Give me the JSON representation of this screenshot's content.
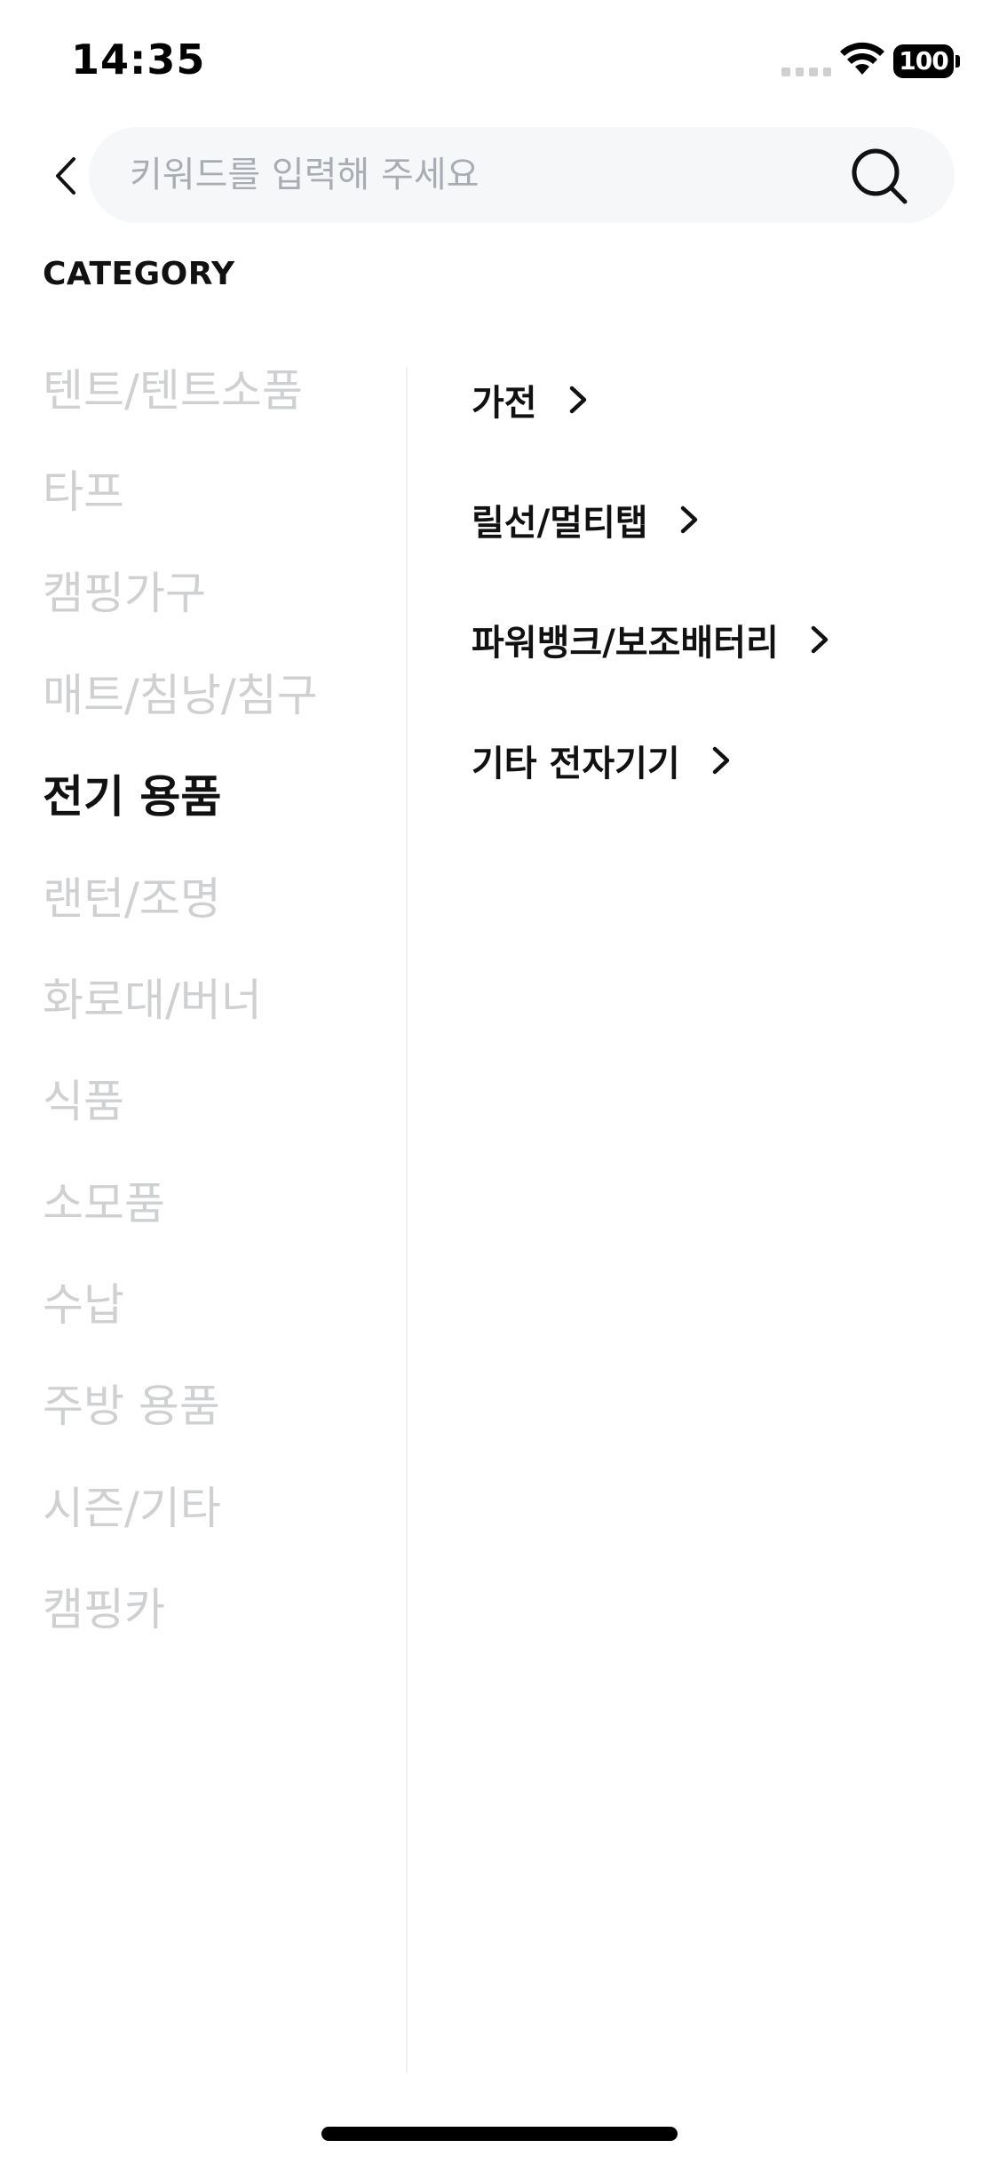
{
  "status_bar": {
    "time": "14:35",
    "battery": "100"
  },
  "search": {
    "placeholder": "키워드를 입력해 주세요",
    "value": ""
  },
  "category_heading": "CATEGORY",
  "left_categories": [
    {
      "label": "텐트/텐트소품",
      "active": false
    },
    {
      "label": "타프",
      "active": false
    },
    {
      "label": "캠핑가구",
      "active": false
    },
    {
      "label": "매트/침낭/침구",
      "active": false
    },
    {
      "label": "전기 용품",
      "active": true
    },
    {
      "label": "랜턴/조명",
      "active": false
    },
    {
      "label": "화로대/버너",
      "active": false
    },
    {
      "label": "식품",
      "active": false
    },
    {
      "label": "소모품",
      "active": false
    },
    {
      "label": "수납",
      "active": false
    },
    {
      "label": "주방 용품",
      "active": false
    },
    {
      "label": "시즌/기타",
      "active": false
    },
    {
      "label": "캠핑카",
      "active": false
    }
  ],
  "subcategories": [
    {
      "label": "가전"
    },
    {
      "label": "릴선/멀티탭"
    },
    {
      "label": "파워뱅크/보조배터리"
    },
    {
      "label": "기타 전자기기"
    }
  ],
  "colors": {
    "active_text": "#111111",
    "inactive_text": "#cfd0d2",
    "search_bg": "#f6f7f9"
  }
}
